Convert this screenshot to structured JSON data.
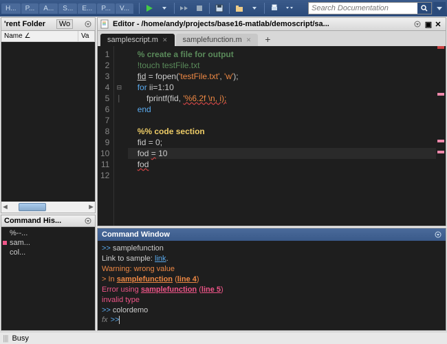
{
  "toolbar": {
    "tabs": [
      "H...",
      "P...",
      "A...",
      "S...",
      "E...",
      "P...",
      "V..."
    ],
    "search_placeholder": "Search Documentation"
  },
  "folder": {
    "title": "'rent Folder",
    "btn": "Wo",
    "cols": [
      "Name ∠",
      "Va"
    ]
  },
  "history": {
    "title": "Command His...",
    "items": [
      {
        "marker": "",
        "text": "%--..."
      },
      {
        "marker": "pink",
        "text": "sam..."
      },
      {
        "marker": "",
        "text": "col..."
      }
    ]
  },
  "editor": {
    "title": "Editor - /home/andy/projects/base16-matlab/demoscript/sa...",
    "tabs": [
      {
        "label": "samplescript.m",
        "active": true
      },
      {
        "label": "samplefunction.m",
        "active": false
      }
    ],
    "lines": [
      {
        "n": 1,
        "seg": [
          {
            "t": "    "
          },
          {
            "t": "% create a file for output",
            "c": "c-comment"
          }
        ]
      },
      {
        "n": 2,
        "seg": [
          {
            "t": "    "
          },
          {
            "t": "!touch testFile.txt",
            "c": "c-syscmd"
          }
        ]
      },
      {
        "n": 3,
        "seg": [
          {
            "t": "    "
          },
          {
            "t": "fid",
            "c": "c-var-und"
          },
          {
            "t": " = fopen("
          },
          {
            "t": "'testFile.txt'",
            "c": "c-string"
          },
          {
            "t": ", "
          },
          {
            "t": "'w'",
            "c": "c-string"
          },
          {
            "t": ");"
          }
        ]
      },
      {
        "n": 4,
        "fold": "⊟",
        "seg": [
          {
            "t": "    "
          },
          {
            "t": "for",
            "c": "c-keyword"
          },
          {
            "t": " ii=1:10"
          }
        ]
      },
      {
        "n": 5,
        "fold": "│",
        "seg": [
          {
            "t": "        fprintf(fid, "
          },
          {
            "t": "'%6.2f \\n, i);",
            "c": "c-string-warn"
          }
        ]
      },
      {
        "n": 6,
        "seg": [
          {
            "t": "    "
          },
          {
            "t": "end",
            "c": "c-keyword"
          }
        ]
      },
      {
        "n": 7,
        "seg": [
          {
            "t": ""
          }
        ]
      },
      {
        "n": 8,
        "seg": [
          {
            "t": "    "
          },
          {
            "t": "%% code section",
            "c": "c-section"
          }
        ]
      },
      {
        "n": 9,
        "seg": [
          {
            "t": "    fid = 0;"
          }
        ]
      },
      {
        "n": 10,
        "current": true,
        "seg": [
          {
            "t": "    fod "
          },
          {
            "t": "=",
            "c": "c-var-warn"
          },
          {
            "t": " 10"
          }
        ]
      },
      {
        "n": 11,
        "seg": [
          {
            "t": "    "
          },
          {
            "t": "fod",
            "c": "c-var-warn"
          }
        ]
      },
      {
        "n": 12,
        "seg": [
          {
            "t": ""
          }
        ]
      }
    ],
    "markers": [
      {
        "pos": 0,
        "c": "red"
      },
      {
        "pos": 70,
        "c": "pink"
      },
      {
        "pos": 140,
        "c": "pink"
      },
      {
        "pos": 158,
        "c": "pink"
      }
    ]
  },
  "cmdwin": {
    "title": "Command Window",
    "lines": [
      [
        {
          "t": ">> ",
          "c": "cmd-prompt"
        },
        {
          "t": "samplefunction"
        }
      ],
      [
        {
          "t": "Link to sample: "
        },
        {
          "t": "link",
          "c": "cmd-link"
        },
        {
          "t": "."
        }
      ],
      [
        {
          "t": "Warning: wrong value",
          "c": "cmd-warn"
        }
      ],
      [
        {
          "t": "> In ",
          "c": "cmd-warn"
        },
        {
          "t": "samplefunction",
          "c": "cmd-warn-link"
        },
        {
          "t": " (",
          "c": "cmd-warn"
        },
        {
          "t": "line 4",
          "c": "cmd-warn-link"
        },
        {
          "t": ")",
          "c": "cmd-warn"
        }
      ],
      [
        {
          "t": "Error using ",
          "c": "cmd-err"
        },
        {
          "t": "samplefunction",
          "c": "cmd-err-link"
        },
        {
          "t": " (",
          "c": "cmd-err"
        },
        {
          "t": "line 5",
          "c": "cmd-err-link"
        },
        {
          "t": ")",
          "c": "cmd-err"
        }
      ],
      [
        {
          "t": "invalid type",
          "c": "cmd-err"
        }
      ],
      [
        {
          "t": ">> ",
          "c": "cmd-prompt"
        },
        {
          "t": "colordemo"
        }
      ]
    ],
    "fx": "fx"
  },
  "status": {
    "text": "Busy"
  }
}
